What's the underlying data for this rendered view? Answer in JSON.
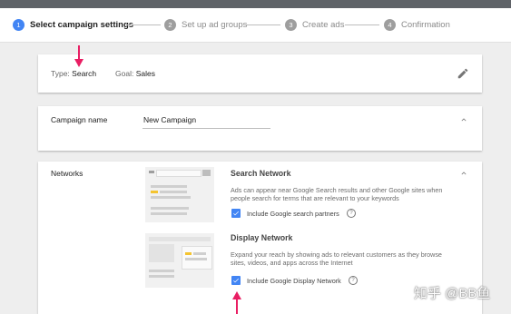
{
  "stepper": {
    "steps": [
      {
        "num": "1",
        "label": "Select campaign settings"
      },
      {
        "num": "2",
        "label": "Set up ad groups"
      },
      {
        "num": "3",
        "label": "Create ads"
      },
      {
        "num": "4",
        "label": "Confirmation"
      }
    ],
    "active_color": "#4285f4"
  },
  "summary": {
    "type_label": "Type:",
    "type_value": "Search",
    "goal_label": "Goal:",
    "goal_value": "Sales"
  },
  "campaign_name": {
    "label": "Campaign name",
    "value": "New Campaign"
  },
  "networks": {
    "label": "Networks",
    "search": {
      "title": "Search Network",
      "description": "Ads can appear near Google Search results and other Google sites when people search for terms that are relevant to your keywords",
      "checkbox_label": "Include Google search partners",
      "checked": true
    },
    "display": {
      "title": "Display Network",
      "description": "Expand your reach by showing ads to relevant customers as they browse sites, videos, and apps across the Internet",
      "checkbox_label": "Include Google Display Network",
      "checked": true
    }
  },
  "watermark": "知乎 @BB鱼",
  "annotation_color": "#e91e63"
}
